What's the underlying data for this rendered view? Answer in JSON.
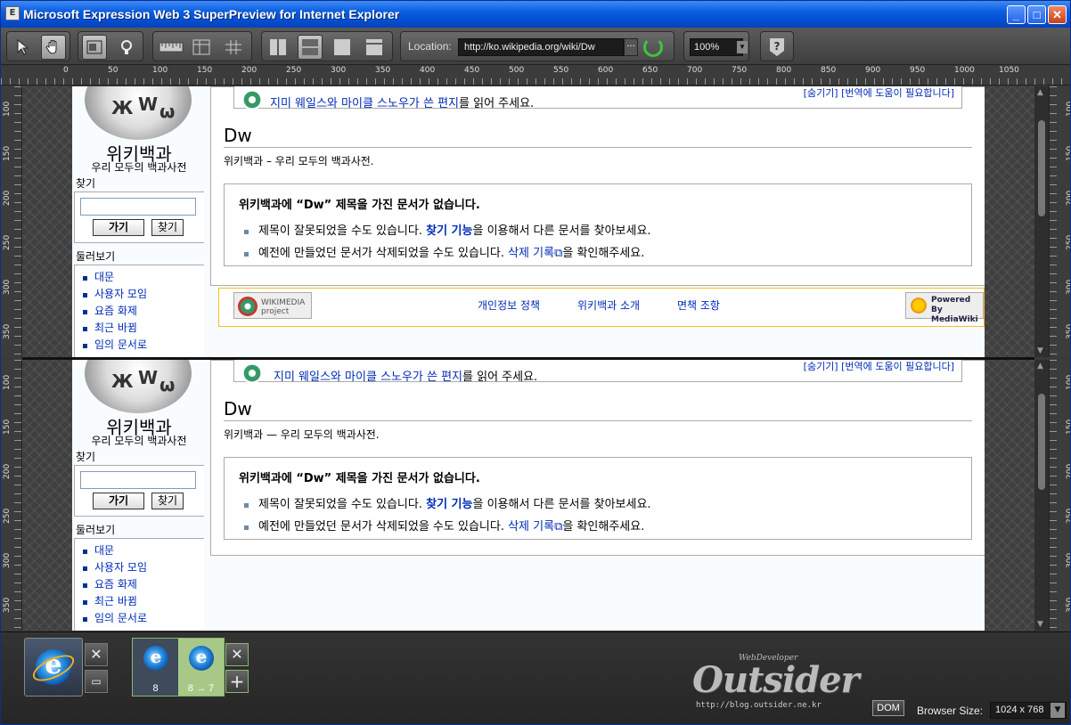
{
  "window": {
    "title": "Microsoft Expression Web 3 SuperPreview for Internet Explorer",
    "min_glyph": "_",
    "max_glyph": "□",
    "close_glyph": "✕"
  },
  "toolbar": {
    "location_label": "Location:",
    "location_value": "http://ko.wikipedia.org/wiki/Dw",
    "location_more": "···",
    "zoom_value": "100%",
    "zoom_dropdown": "▼",
    "help_glyph": "?"
  },
  "ruler": {
    "top_ticks": [
      "0",
      "50",
      "100",
      "150",
      "200",
      "250",
      "300",
      "350",
      "400",
      "450",
      "500",
      "550",
      "600",
      "650",
      "700",
      "750",
      "800",
      "850",
      "900",
      "950",
      "1000",
      "1050"
    ],
    "left_ticks": [
      "100",
      "150",
      "200",
      "250",
      "300",
      "350"
    ]
  },
  "page": {
    "wiki_name": "위키백과",
    "wiki_tagline": "우리 모두의 백과사전",
    "search_heading": "찾기",
    "go_button": "가기",
    "search_button": "찾기",
    "nav_heading": "둘러보기",
    "nav_items": [
      "대문",
      "사용자 모임",
      "요즘 화제",
      "최근 바뀜",
      "임의 문서로"
    ],
    "notice_link": "지미 웨일스와 마이클 스노우가 쓴 편지",
    "notice_suffix": "를 읽어 주세요.",
    "notice_right": "[숨기기] [번역에 도움이 필요합니다]",
    "title": "Dw",
    "subtitle_top": "위키백과 – 우리 모두의 백과사전.",
    "subtitle_bottom": "위키백과 — 우리 모두의 백과사전.",
    "nobox_heading": "위키백과에 “Dw” 제목을 가진 문서가 없습니다.",
    "nobox_line1_pre": "제목이 잘못되었을 수도 있습니다. ",
    "nobox_line1_link": "찾기 기능",
    "nobox_line1_post": "을 이용해서 다른 문서를 찾아보세요.",
    "nobox_line2_pre": "예전에 만들었던 문서가 삭제되었을 수도 있습니다. ",
    "nobox_line2_link": "삭제 기록",
    "nobox_line2_post": "을 확인해주세요.",
    "footer_links": [
      "개인정보 정책",
      "위키백과 소개",
      "면책 조항"
    ],
    "wikimedia_badge": "WIKIMEDIA project",
    "mediawiki_badge": "Powered By MediaWiki"
  },
  "bottom": {
    "close_glyph": "✕",
    "save_glyph": "▭",
    "add_glyph": "+",
    "ie_version_left": "8",
    "ie_version_right": "8 → 7",
    "brand_small": "WebDeveloper",
    "brand_big": "Outsider",
    "brand_url": "http://blog.outsider.ne.kr",
    "dom_label": "DOM",
    "browser_size_label": "Browser Size:",
    "browser_size_value": "1024 x 768",
    "browser_size_dropdown": "▼"
  }
}
